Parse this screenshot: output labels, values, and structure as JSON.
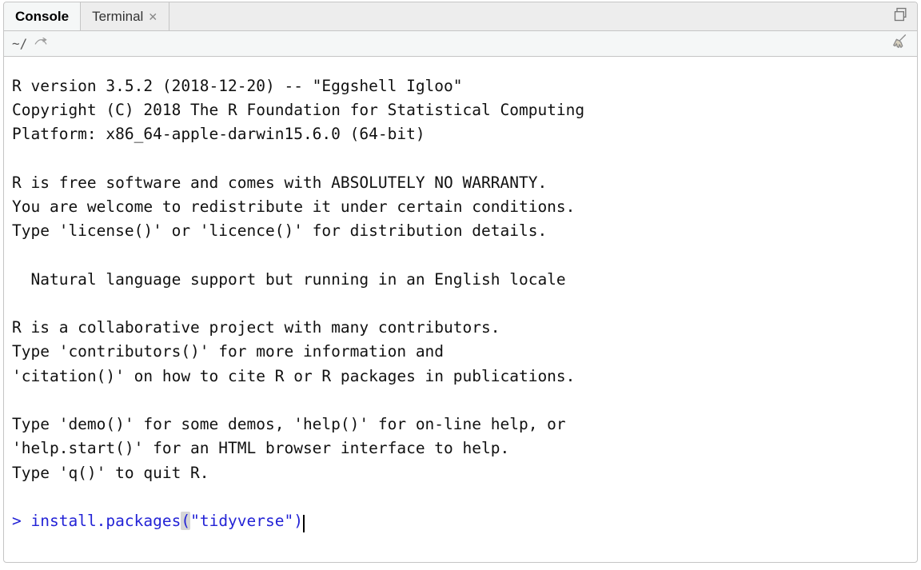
{
  "tabs": {
    "console_label": "Console",
    "terminal_label": "Terminal"
  },
  "toolbar": {
    "working_dir": "~/"
  },
  "console": {
    "startup_text": "R version 3.5.2 (2018-12-20) -- \"Eggshell Igloo\"\nCopyright (C) 2018 The R Foundation for Statistical Computing\nPlatform: x86_64-apple-darwin15.6.0 (64-bit)\n\nR is free software and comes with ABSOLUTELY NO WARRANTY.\nYou are welcome to redistribute it under certain conditions.\nType 'license()' or 'licence()' for distribution details.\n\n  Natural language support but running in an English locale\n\nR is a collaborative project with many contributors.\nType 'contributors()' for more information and\n'citation()' on how to cite R or R packages in publications.\n\nType 'demo()' for some demos, 'help()' for on-line help, or\n'help.start()' for an HTML browser interface to help.\nType 'q()' to quit R.\n",
    "prompt_symbol": ">",
    "command_func": "install.packages",
    "command_open_paren": "(",
    "command_string": "\"tidyverse\"",
    "command_close_paren": ")"
  }
}
